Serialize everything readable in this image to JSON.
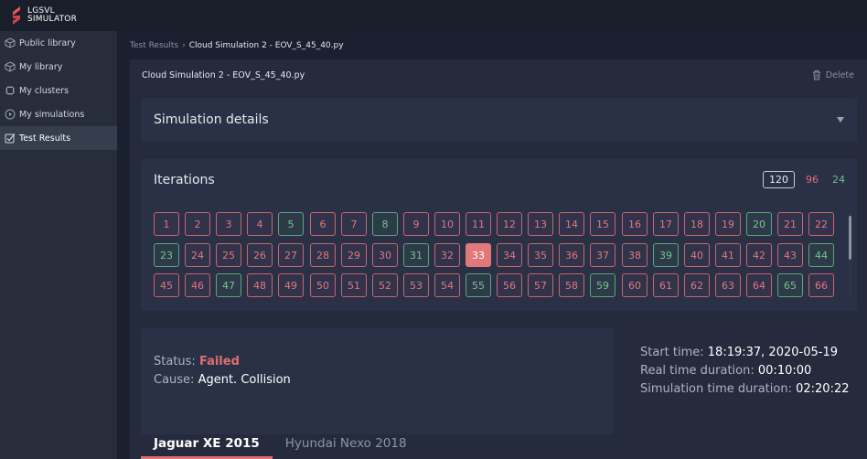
{
  "app": {
    "logo_line1": "LGSVL",
    "logo_line2": "SIMULATOR"
  },
  "sidebar": {
    "items": [
      {
        "label": "Public library",
        "icon": "cube-icon"
      },
      {
        "label": "My library",
        "icon": "cube-outline-icon"
      },
      {
        "label": "My clusters",
        "icon": "chip-icon"
      },
      {
        "label": "My simulations",
        "icon": "play-circle-icon"
      },
      {
        "label": "Test Results",
        "icon": "checklist-icon",
        "active": true
      }
    ]
  },
  "breadcrumb": {
    "parent": "Test Results",
    "separator": "›",
    "current": "Cloud Simulation 2 - EOV_S_45_40.py"
  },
  "header": {
    "title": "Cloud Simulation 2 - EOV_S_45_40.py",
    "delete_label": "Delete"
  },
  "details": {
    "title": "Simulation details"
  },
  "iterations": {
    "title": "Iterations",
    "total": "120",
    "failed": "96",
    "passed": "24",
    "selected": 33,
    "passed_ids": [
      5,
      8,
      20,
      23,
      31,
      39,
      44,
      47,
      55,
      59,
      65
    ],
    "visible_count": 66
  },
  "status": {
    "status_label": "Status:",
    "status_value": "Failed",
    "cause_label": "Cause:",
    "cause_value": "Agent. Collision"
  },
  "times": {
    "start_label": "Start time:",
    "start_value": "18:19:37, 2020-05-19",
    "real_label": "Real time duration:",
    "real_value": "00:10:00",
    "sim_label": "Simulation time duration:",
    "sim_value": "02:20:22"
  },
  "tabs": [
    {
      "label": "Jaguar XE 2015",
      "active": true
    },
    {
      "label": "Hyundai Nexo 2018",
      "active": false
    }
  ],
  "colors": {
    "fail": "#e16e72",
    "pass": "#6fbd86",
    "accent": "#e16e72"
  }
}
